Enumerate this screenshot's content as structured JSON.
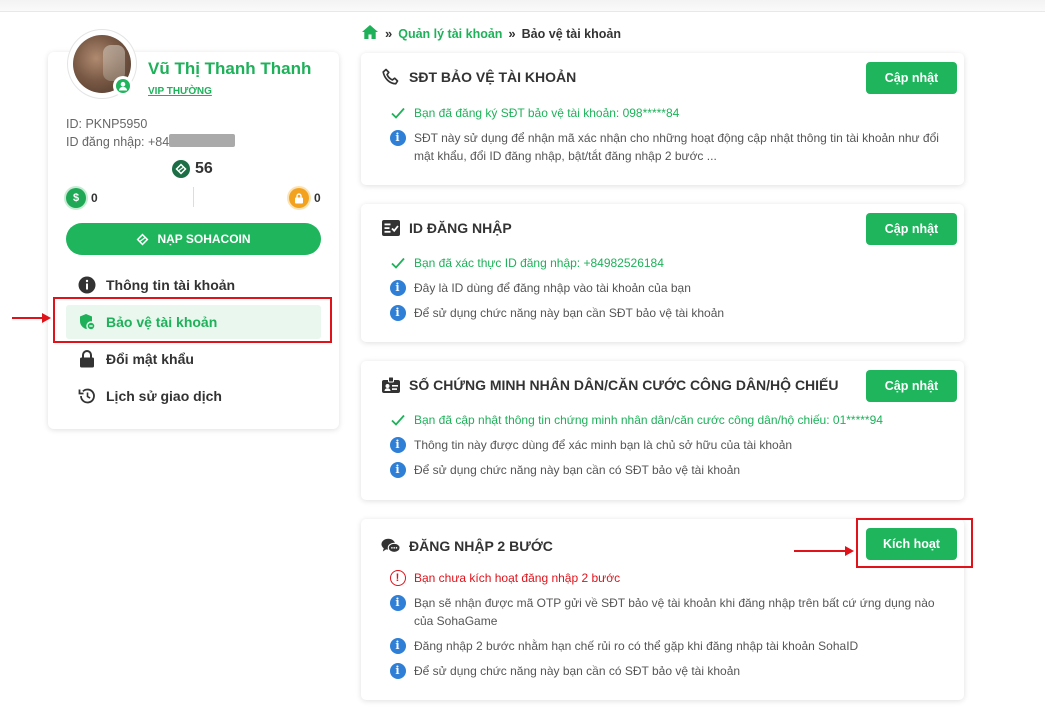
{
  "user": {
    "name": "Vũ Thị Thanh Thanh",
    "tier": "VIP THƯỜNG",
    "id_line": "ID: PKNP5950",
    "login_id_line": "ID đăng nhập: +84",
    "coins": "56",
    "balance_left": "0",
    "balance_right": "0"
  },
  "sidebar": {
    "topup_label": "NẠP SOHACOIN",
    "items": [
      {
        "label": "Thông tin tài khoản",
        "icon": "info-circle-icon"
      },
      {
        "label": "Bảo vệ tài khoản",
        "icon": "shield-icon"
      },
      {
        "label": "Đổi mật khẩu",
        "icon": "lock-icon"
      },
      {
        "label": "Lịch sử giao dịch",
        "icon": "history-icon"
      }
    ]
  },
  "breadcrumb": {
    "link": "Quản lý tài khoản",
    "current": "Bảo vệ tài khoản"
  },
  "cards": [
    {
      "title": "SĐT BẢO VỆ TÀI KHOẢN",
      "button": "Cập nhật",
      "lines": [
        "Bạn đã đăng ký SĐT bảo vệ tài khoản: 098*****84",
        "SĐT này sử dụng để nhận mã xác nhận cho những hoạt động cập nhật thông tin tài khoản như đổi mật khẩu, đổi ID đăng nhập, bật/tắt đăng nhập 2 bước ..."
      ]
    },
    {
      "title": "ID ĐĂNG NHẬP",
      "button": "Cập nhật",
      "lines": [
        "Bạn đã xác thực ID đăng nhập: +84982526184",
        "Đây là ID dùng để đăng nhập vào tài khoản của bạn",
        "Để sử dụng chức năng này bạn cần SĐT bảo vệ tài khoản"
      ]
    },
    {
      "title": "SỐ CHỨNG MINH NHÂN DÂN/CĂN CƯỚC CÔNG DÂN/HỘ CHIẾU",
      "button": "Cập nhật",
      "lines": [
        "Bạn đã cập nhật thông tin chứng minh nhân dân/căn cước công dân/hộ chiếu: 01*****94",
        "Thông tin này được dùng để xác minh bạn là chủ sở hữu của tài khoản",
        "Để sử dụng chức năng này bạn cần có SĐT bảo vệ tài khoản"
      ]
    },
    {
      "title": "ĐĂNG NHẬP 2 BƯỚC",
      "button": "Kích hoạt",
      "lines": [
        "Bạn chưa kích hoạt đăng nhập 2 bước",
        "Bạn sẽ nhận được mã OTP gửi về SĐT bảo vệ tài khoản khi đăng nhập trên bất cứ ứng dụng nào của SohaGame",
        "Đăng nhập 2 bước nhằm hạn chế rủi ro có thể gặp khi đăng nhập tài khoản SohaID",
        "Để sử dụng chức năng này bạn cần có SĐT bảo vệ tài khoản"
      ]
    }
  ],
  "colors": {
    "accent": "#1fb55d",
    "info": "#2f7fd6",
    "error": "#e0121a"
  }
}
